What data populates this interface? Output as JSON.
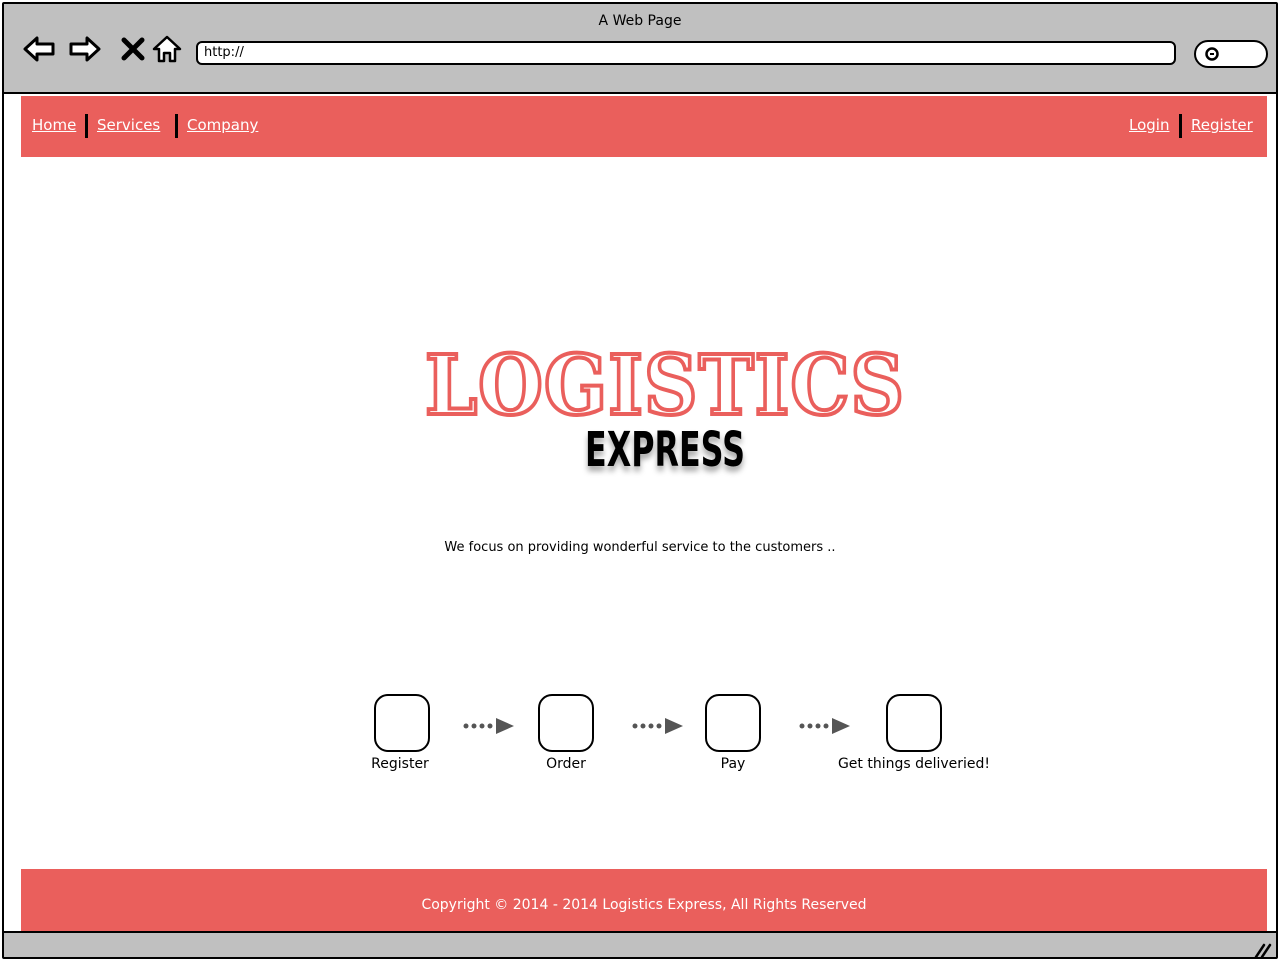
{
  "window": {
    "title": "A Web Page"
  },
  "address_bar": {
    "value": "http://"
  },
  "nav": {
    "left": [
      "Home",
      "Services",
      "Company"
    ],
    "right": [
      "Login",
      "Register"
    ]
  },
  "hero": {
    "logo_top": "LOGISTICS",
    "logo_bottom": "EXPRESS",
    "tagline": "We focus on providing wonderful service to the customers .."
  },
  "steps": [
    "Register",
    "Order",
    "Pay",
    "Get things deliveried!"
  ],
  "footer": {
    "copyright": "Copyright © 2014 - 2014 Logistics Express, All Rights Reserved"
  },
  "colors": {
    "brand": "#ea5f5c",
    "chrome": "#c0c0c0"
  },
  "icons": [
    "back-arrow-icon",
    "forward-arrow-icon",
    "stop-icon",
    "home-icon",
    "search-icon",
    "resize-grip-icon"
  ]
}
